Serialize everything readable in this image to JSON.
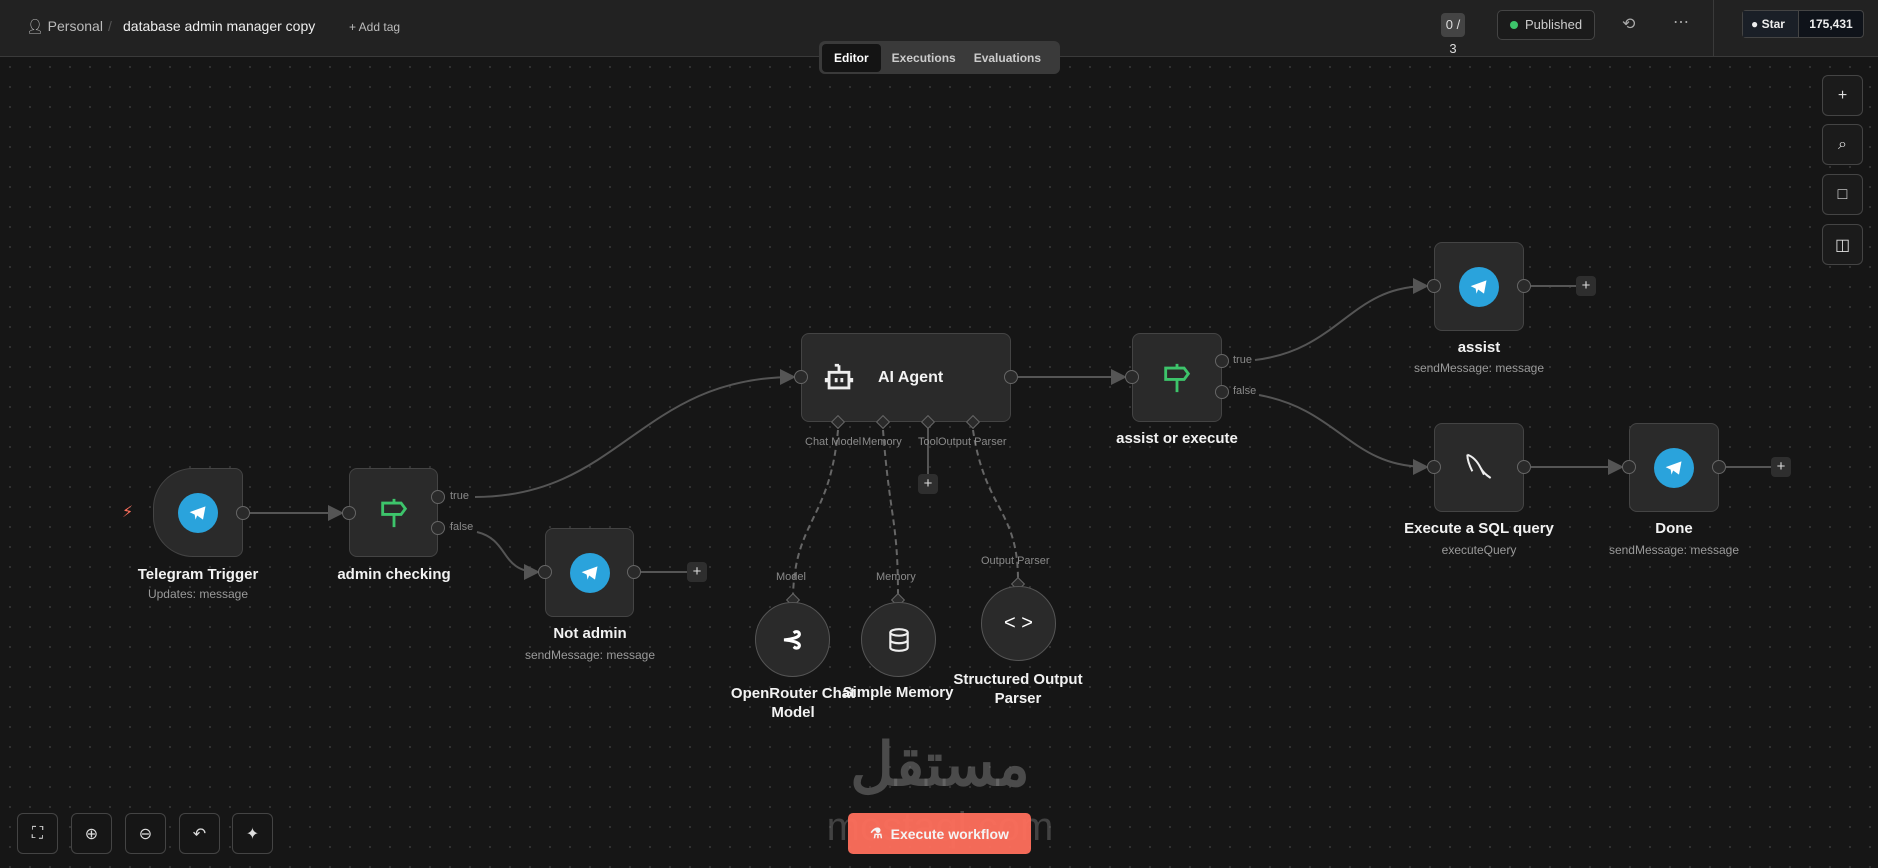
{
  "header": {
    "breadcrumb_project": "Personal",
    "workflow_name": "database admin manager copy",
    "add_tag": "+ Add tag",
    "counter": "0 / 3",
    "status": "Published",
    "status_color": "#3dc46b",
    "github_star": "Star",
    "github_count": "175,431"
  },
  "tabs": [
    {
      "label": "Editor",
      "active": true
    },
    {
      "label": "Executions"
    },
    {
      "label": "Evaluations"
    }
  ],
  "nodes": {
    "telegram_trigger": {
      "name": "Telegram Trigger",
      "sub": "Updates: message"
    },
    "admin_checking": {
      "name": "admin checking",
      "true": "true",
      "false": "false"
    },
    "not_admin": {
      "name": "Not admin",
      "sub": "sendMessage: message"
    },
    "ai_agent": {
      "name": "AI Agent",
      "inputs": [
        "Chat Model",
        "Memory",
        "Tool",
        "Output Parser"
      ]
    },
    "assist_or_execute": {
      "name": "assist or execute",
      "true": "true",
      "false": "false"
    },
    "assist": {
      "name": "assist",
      "sub": "sendMessage: message"
    },
    "sql": {
      "name": "Execute a SQL query",
      "sub": "executeQuery"
    },
    "done": {
      "name": "Done",
      "sub": "sendMessage: message"
    },
    "openrouter": {
      "name": "OpenRouter Chat Model",
      "port": "Model"
    },
    "memory": {
      "name": "Simple Memory",
      "port": "Memory"
    },
    "parser": {
      "name": "Structured Output Parser",
      "port": "Output Parser"
    }
  },
  "execute_button": "Execute workflow",
  "watermark": {
    "arabic": "مستقل",
    "latin": "mostaql.com"
  },
  "colors": {
    "accent": "#ff6f5c",
    "telegram": "#2aa3dc",
    "if_icon": "#3dc46b"
  }
}
